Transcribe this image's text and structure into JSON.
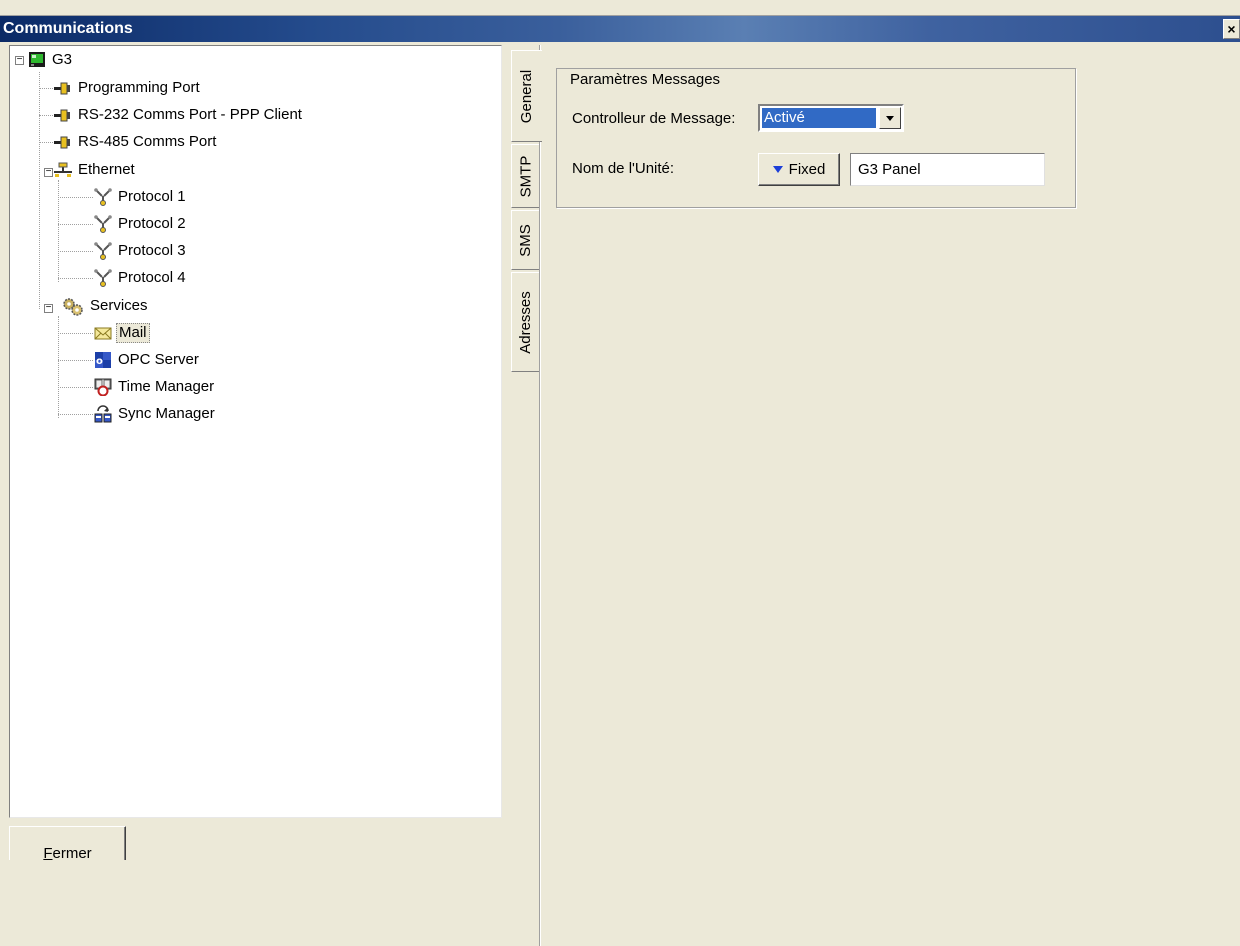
{
  "window": {
    "title": "Communications",
    "close_label": "×"
  },
  "tree": {
    "root": {
      "label": "G3",
      "icon": "panel-icon"
    },
    "items": [
      {
        "label": "Programming Port",
        "icon": "port-icon"
      },
      {
        "label": "RS-232 Comms Port - PPP Client",
        "icon": "port-icon"
      },
      {
        "label": "RS-485 Comms Port",
        "icon": "port-icon"
      },
      {
        "label": "Ethernet",
        "icon": "network-icon"
      },
      {
        "label": "Protocol 1",
        "icon": "protocol-icon"
      },
      {
        "label": "Protocol 2",
        "icon": "protocol-icon"
      },
      {
        "label": "Protocol 3",
        "icon": "protocol-icon"
      },
      {
        "label": "Protocol 4",
        "icon": "protocol-icon"
      },
      {
        "label": "Services",
        "icon": "gears-icon"
      },
      {
        "label": "Mail",
        "icon": "mail-icon",
        "selected": true
      },
      {
        "label": "OPC Server",
        "icon": "opc-server-icon"
      },
      {
        "label": "Time Manager",
        "icon": "clock-icon"
      },
      {
        "label": "Sync Manager",
        "icon": "sync-icon"
      }
    ]
  },
  "footer": {
    "close_button": "Fermer",
    "close_mnemonic": "F",
    "close_rest": "ermer"
  },
  "tabs": [
    {
      "label": "General",
      "active": true
    },
    {
      "label": "SMTP"
    },
    {
      "label": "SMS"
    },
    {
      "label": "Adresses"
    }
  ],
  "group": {
    "title": "Paramètres Messages",
    "controller_label": "Controlleur de Message:",
    "controller_value": "Activé",
    "unit_label": "Nom de l'Unité:",
    "unit_mode": "Fixed",
    "unit_value": "G3 Panel"
  },
  "colors": {
    "titlebar": "#244b8c",
    "selection": "#316ac5",
    "face": "#ece9d8",
    "arrow": "#1c3fd8"
  }
}
